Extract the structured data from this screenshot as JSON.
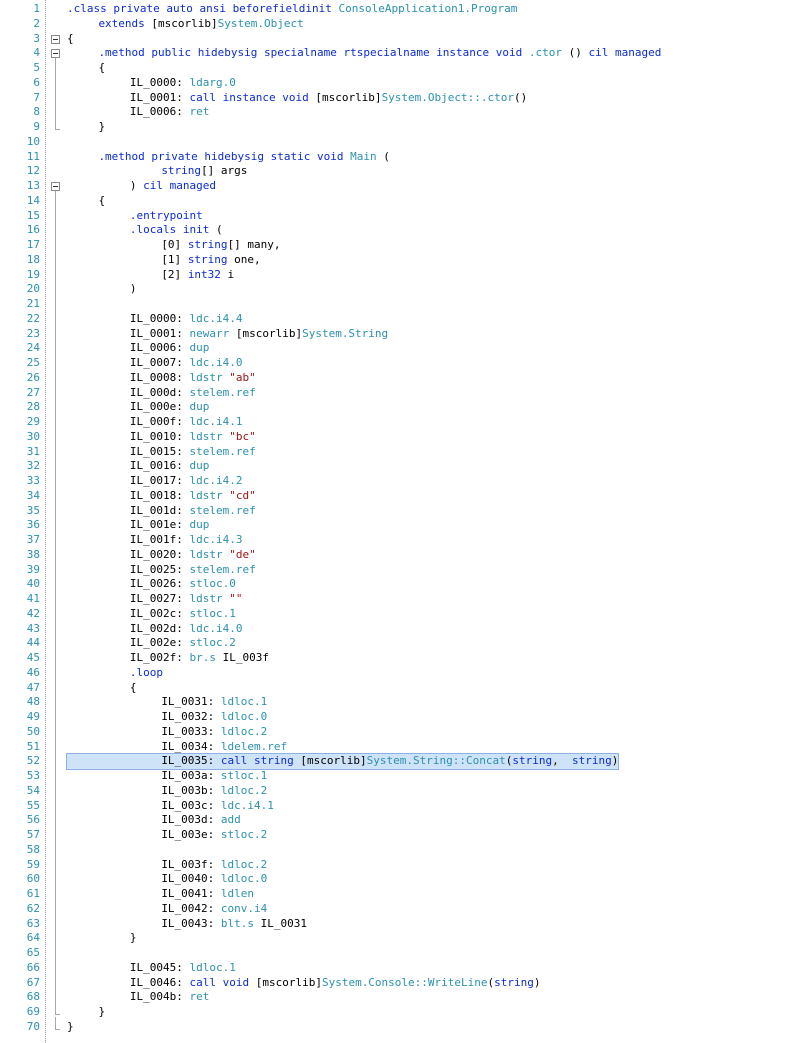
{
  "colors": {
    "keyword": "#0b2bd6",
    "type": "#2b91af",
    "string": "#a31515",
    "line_number": "#2b91af",
    "highlight": "#cfe3f8"
  },
  "highlighted_line": 52,
  "fold_icon": "collapse-minus-icon",
  "lines": [
    {
      "n": "1",
      "indent": 0,
      "tokens": [
        {
          "t": ".class private auto ansi beforefieldinit ",
          "c": "kw"
        },
        {
          "t": "ConsoleApplication1.Program",
          "c": "ty"
        }
      ]
    },
    {
      "n": "2",
      "indent": 4,
      "tokens": [
        {
          "t": "extends ",
          "c": "kw"
        },
        {
          "t": "[mscorlib]",
          "c": ""
        },
        {
          "t": "System.Object",
          "c": "ty"
        }
      ]
    },
    {
      "n": "3",
      "indent": 0,
      "tokens": [
        {
          "t": "{",
          "c": ""
        }
      ]
    },
    {
      "n": "4",
      "indent": 4,
      "tokens": [
        {
          "t": ".method public hidebysig specialname rtspecialname instance void ",
          "c": "kw"
        },
        {
          "t": ".ctor",
          "c": "ty"
        },
        {
          "t": " () ",
          "c": ""
        },
        {
          "t": "cil managed",
          "c": "kw"
        }
      ]
    },
    {
      "n": "5",
      "indent": 4,
      "tokens": [
        {
          "t": "{",
          "c": ""
        }
      ]
    },
    {
      "n": "6",
      "indent": 8,
      "tokens": [
        {
          "t": "IL_0000: ",
          "c": ""
        },
        {
          "t": "ldarg.0",
          "c": "ty"
        }
      ]
    },
    {
      "n": "7",
      "indent": 8,
      "tokens": [
        {
          "t": "IL_0001: ",
          "c": ""
        },
        {
          "t": "call instance void ",
          "c": "kw"
        },
        {
          "t": "[mscorlib]",
          "c": ""
        },
        {
          "t": "System.Object::.ctor",
          "c": "ty"
        },
        {
          "t": "()",
          "c": ""
        }
      ]
    },
    {
      "n": "8",
      "indent": 8,
      "tokens": [
        {
          "t": "IL_0006: ",
          "c": ""
        },
        {
          "t": "ret",
          "c": "ty"
        }
      ]
    },
    {
      "n": "9",
      "indent": 4,
      "tokens": [
        {
          "t": "}",
          "c": ""
        }
      ]
    },
    {
      "n": "10",
      "indent": 0,
      "tokens": []
    },
    {
      "n": "11",
      "indent": 4,
      "tokens": [
        {
          "t": ".method private hidebysig static void ",
          "c": "kw"
        },
        {
          "t": "Main",
          "c": "ty"
        },
        {
          "t": " (",
          "c": ""
        }
      ]
    },
    {
      "n": "12",
      "indent": 12,
      "tokens": [
        {
          "t": "string",
          "c": "kw"
        },
        {
          "t": "[] args",
          "c": ""
        }
      ]
    },
    {
      "n": "13",
      "indent": 8,
      "tokens": [
        {
          "t": ") ",
          "c": ""
        },
        {
          "t": "cil managed",
          "c": "kw"
        }
      ]
    },
    {
      "n": "14",
      "indent": 4,
      "tokens": [
        {
          "t": "{",
          "c": ""
        }
      ]
    },
    {
      "n": "15",
      "indent": 8,
      "tokens": [
        {
          "t": ".entrypoint",
          "c": "kw"
        }
      ]
    },
    {
      "n": "16",
      "indent": 8,
      "tokens": [
        {
          "t": ".locals init ",
          "c": "kw"
        },
        {
          "t": "(",
          "c": ""
        }
      ]
    },
    {
      "n": "17",
      "indent": 12,
      "tokens": [
        {
          "t": "[0] ",
          "c": ""
        },
        {
          "t": "string",
          "c": "kw"
        },
        {
          "t": "[] many,",
          "c": ""
        }
      ]
    },
    {
      "n": "18",
      "indent": 12,
      "tokens": [
        {
          "t": "[1] ",
          "c": ""
        },
        {
          "t": "string",
          "c": "kw"
        },
        {
          "t": " one,",
          "c": ""
        }
      ]
    },
    {
      "n": "19",
      "indent": 12,
      "tokens": [
        {
          "t": "[2] ",
          "c": ""
        },
        {
          "t": "int32",
          "c": "kw"
        },
        {
          "t": " i",
          "c": ""
        }
      ]
    },
    {
      "n": "20",
      "indent": 8,
      "tokens": [
        {
          "t": ")",
          "c": ""
        }
      ]
    },
    {
      "n": "21",
      "indent": 0,
      "tokens": []
    },
    {
      "n": "22",
      "indent": 8,
      "tokens": [
        {
          "t": "IL_0000: ",
          "c": ""
        },
        {
          "t": "ldc.i4.4",
          "c": "ty"
        }
      ]
    },
    {
      "n": "23",
      "indent": 8,
      "tokens": [
        {
          "t": "IL_0001: ",
          "c": ""
        },
        {
          "t": "newarr ",
          "c": "ty"
        },
        {
          "t": "[mscorlib]",
          "c": ""
        },
        {
          "t": "System.String",
          "c": "ty"
        }
      ]
    },
    {
      "n": "24",
      "indent": 8,
      "tokens": [
        {
          "t": "IL_0006: ",
          "c": ""
        },
        {
          "t": "dup",
          "c": "ty"
        }
      ]
    },
    {
      "n": "25",
      "indent": 8,
      "tokens": [
        {
          "t": "IL_0007: ",
          "c": ""
        },
        {
          "t": "ldc.i4.0",
          "c": "ty"
        }
      ]
    },
    {
      "n": "26",
      "indent": 8,
      "tokens": [
        {
          "t": "IL_0008: ",
          "c": ""
        },
        {
          "t": "ldstr ",
          "c": "ty"
        },
        {
          "t": "\"ab\"",
          "c": "str"
        }
      ]
    },
    {
      "n": "27",
      "indent": 8,
      "tokens": [
        {
          "t": "IL_000d: ",
          "c": ""
        },
        {
          "t": "stelem.ref",
          "c": "ty"
        }
      ]
    },
    {
      "n": "28",
      "indent": 8,
      "tokens": [
        {
          "t": "IL_000e: ",
          "c": ""
        },
        {
          "t": "dup",
          "c": "ty"
        }
      ]
    },
    {
      "n": "29",
      "indent": 8,
      "tokens": [
        {
          "t": "IL_000f: ",
          "c": ""
        },
        {
          "t": "ldc.i4.1",
          "c": "ty"
        }
      ]
    },
    {
      "n": "30",
      "indent": 8,
      "tokens": [
        {
          "t": "IL_0010: ",
          "c": ""
        },
        {
          "t": "ldstr ",
          "c": "ty"
        },
        {
          "t": "\"bc\"",
          "c": "str"
        }
      ]
    },
    {
      "n": "31",
      "indent": 8,
      "tokens": [
        {
          "t": "IL_0015: ",
          "c": ""
        },
        {
          "t": "stelem.ref",
          "c": "ty"
        }
      ]
    },
    {
      "n": "32",
      "indent": 8,
      "tokens": [
        {
          "t": "IL_0016: ",
          "c": ""
        },
        {
          "t": "dup",
          "c": "ty"
        }
      ]
    },
    {
      "n": "33",
      "indent": 8,
      "tokens": [
        {
          "t": "IL_0017: ",
          "c": ""
        },
        {
          "t": "ldc.i4.2",
          "c": "ty"
        }
      ]
    },
    {
      "n": "34",
      "indent": 8,
      "tokens": [
        {
          "t": "IL_0018: ",
          "c": ""
        },
        {
          "t": "ldstr ",
          "c": "ty"
        },
        {
          "t": "\"cd\"",
          "c": "str"
        }
      ]
    },
    {
      "n": "35",
      "indent": 8,
      "tokens": [
        {
          "t": "IL_001d: ",
          "c": ""
        },
        {
          "t": "stelem.ref",
          "c": "ty"
        }
      ]
    },
    {
      "n": "36",
      "indent": 8,
      "tokens": [
        {
          "t": "IL_001e: ",
          "c": ""
        },
        {
          "t": "dup",
          "c": "ty"
        }
      ]
    },
    {
      "n": "37",
      "indent": 8,
      "tokens": [
        {
          "t": "IL_001f: ",
          "c": ""
        },
        {
          "t": "ldc.i4.3",
          "c": "ty"
        }
      ]
    },
    {
      "n": "38",
      "indent": 8,
      "tokens": [
        {
          "t": "IL_0020: ",
          "c": ""
        },
        {
          "t": "ldstr ",
          "c": "ty"
        },
        {
          "t": "\"de\"",
          "c": "str"
        }
      ]
    },
    {
      "n": "39",
      "indent": 8,
      "tokens": [
        {
          "t": "IL_0025: ",
          "c": ""
        },
        {
          "t": "stelem.ref",
          "c": "ty"
        }
      ]
    },
    {
      "n": "40",
      "indent": 8,
      "tokens": [
        {
          "t": "IL_0026: ",
          "c": ""
        },
        {
          "t": "stloc.0",
          "c": "ty"
        }
      ]
    },
    {
      "n": "41",
      "indent": 8,
      "tokens": [
        {
          "t": "IL_0027: ",
          "c": ""
        },
        {
          "t": "ldstr ",
          "c": "ty"
        },
        {
          "t": "\"\"",
          "c": "str"
        }
      ]
    },
    {
      "n": "42",
      "indent": 8,
      "tokens": [
        {
          "t": "IL_002c: ",
          "c": ""
        },
        {
          "t": "stloc.1",
          "c": "ty"
        }
      ]
    },
    {
      "n": "43",
      "indent": 8,
      "tokens": [
        {
          "t": "IL_002d: ",
          "c": ""
        },
        {
          "t": "ldc.i4.0",
          "c": "ty"
        }
      ]
    },
    {
      "n": "44",
      "indent": 8,
      "tokens": [
        {
          "t": "IL_002e: ",
          "c": ""
        },
        {
          "t": "stloc.2",
          "c": "ty"
        }
      ]
    },
    {
      "n": "45",
      "indent": 8,
      "tokens": [
        {
          "t": "IL_002f: ",
          "c": ""
        },
        {
          "t": "br.s ",
          "c": "ty"
        },
        {
          "t": "IL_003f",
          "c": ""
        }
      ]
    },
    {
      "n": "46",
      "indent": 8,
      "tokens": [
        {
          "t": ".loop",
          "c": "kw"
        }
      ]
    },
    {
      "n": "47",
      "indent": 8,
      "tokens": [
        {
          "t": "{",
          "c": ""
        }
      ]
    },
    {
      "n": "48",
      "indent": 12,
      "tokens": [
        {
          "t": "IL_0031: ",
          "c": ""
        },
        {
          "t": "ldloc.1",
          "c": "ty"
        }
      ]
    },
    {
      "n": "49",
      "indent": 12,
      "tokens": [
        {
          "t": "IL_0032: ",
          "c": ""
        },
        {
          "t": "ldloc.0",
          "c": "ty"
        }
      ]
    },
    {
      "n": "50",
      "indent": 12,
      "tokens": [
        {
          "t": "IL_0033: ",
          "c": ""
        },
        {
          "t": "ldloc.2",
          "c": "ty"
        }
      ]
    },
    {
      "n": "51",
      "indent": 12,
      "tokens": [
        {
          "t": "IL_0034: ",
          "c": ""
        },
        {
          "t": "ldelem.ref",
          "c": "ty"
        }
      ]
    },
    {
      "n": "52",
      "indent": 12,
      "tokens": [
        {
          "t": "IL_0035: ",
          "c": ""
        },
        {
          "t": "call string ",
          "c": "kw"
        },
        {
          "t": "[mscorlib]",
          "c": ""
        },
        {
          "t": "System.String::Concat",
          "c": "ty"
        },
        {
          "t": "(",
          "c": ""
        },
        {
          "t": "string",
          "c": "kw"
        },
        {
          "t": ",  ",
          "c": ""
        },
        {
          "t": "string",
          "c": "kw"
        },
        {
          "t": ")",
          "c": ""
        }
      ]
    },
    {
      "n": "53",
      "indent": 12,
      "tokens": [
        {
          "t": "IL_003a: ",
          "c": ""
        },
        {
          "t": "stloc.1",
          "c": "ty"
        }
      ]
    },
    {
      "n": "54",
      "indent": 12,
      "tokens": [
        {
          "t": "IL_003b: ",
          "c": ""
        },
        {
          "t": "ldloc.2",
          "c": "ty"
        }
      ]
    },
    {
      "n": "55",
      "indent": 12,
      "tokens": [
        {
          "t": "IL_003c: ",
          "c": ""
        },
        {
          "t": "ldc.i4.1",
          "c": "ty"
        }
      ]
    },
    {
      "n": "56",
      "indent": 12,
      "tokens": [
        {
          "t": "IL_003d: ",
          "c": ""
        },
        {
          "t": "add",
          "c": "ty"
        }
      ]
    },
    {
      "n": "57",
      "indent": 12,
      "tokens": [
        {
          "t": "IL_003e: ",
          "c": ""
        },
        {
          "t": "stloc.2",
          "c": "ty"
        }
      ]
    },
    {
      "n": "58",
      "indent": 0,
      "tokens": []
    },
    {
      "n": "59",
      "indent": 12,
      "tokens": [
        {
          "t": "IL_003f: ",
          "c": ""
        },
        {
          "t": "ldloc.2",
          "c": "ty"
        }
      ]
    },
    {
      "n": "60",
      "indent": 12,
      "tokens": [
        {
          "t": "IL_0040: ",
          "c": ""
        },
        {
          "t": "ldloc.0",
          "c": "ty"
        }
      ]
    },
    {
      "n": "61",
      "indent": 12,
      "tokens": [
        {
          "t": "IL_0041: ",
          "c": ""
        },
        {
          "t": "ldlen",
          "c": "ty"
        }
      ]
    },
    {
      "n": "62",
      "indent": 12,
      "tokens": [
        {
          "t": "IL_0042: ",
          "c": ""
        },
        {
          "t": "conv.i4",
          "c": "ty"
        }
      ]
    },
    {
      "n": "63",
      "indent": 12,
      "tokens": [
        {
          "t": "IL_0043: ",
          "c": ""
        },
        {
          "t": "blt.s ",
          "c": "ty"
        },
        {
          "t": "IL_0031",
          "c": ""
        }
      ]
    },
    {
      "n": "64",
      "indent": 8,
      "tokens": [
        {
          "t": "}",
          "c": ""
        }
      ]
    },
    {
      "n": "65",
      "indent": 0,
      "tokens": []
    },
    {
      "n": "66",
      "indent": 8,
      "tokens": [
        {
          "t": "IL_0045: ",
          "c": ""
        },
        {
          "t": "ldloc.1",
          "c": "ty"
        }
      ]
    },
    {
      "n": "67",
      "indent": 8,
      "tokens": [
        {
          "t": "IL_0046: ",
          "c": ""
        },
        {
          "t": "call void ",
          "c": "kw"
        },
        {
          "t": "[mscorlib]",
          "c": ""
        },
        {
          "t": "System.Console::WriteLine",
          "c": "ty"
        },
        {
          "t": "(",
          "c": ""
        },
        {
          "t": "string",
          "c": "kw"
        },
        {
          "t": ")",
          "c": ""
        }
      ]
    },
    {
      "n": "68",
      "indent": 8,
      "tokens": [
        {
          "t": "IL_004b: ",
          "c": ""
        },
        {
          "t": "ret",
          "c": "ty"
        }
      ]
    },
    {
      "n": "69",
      "indent": 4,
      "tokens": [
        {
          "t": "}",
          "c": ""
        }
      ]
    },
    {
      "n": "70",
      "indent": 0,
      "tokens": [
        {
          "t": "}",
          "c": ""
        }
      ]
    }
  ]
}
